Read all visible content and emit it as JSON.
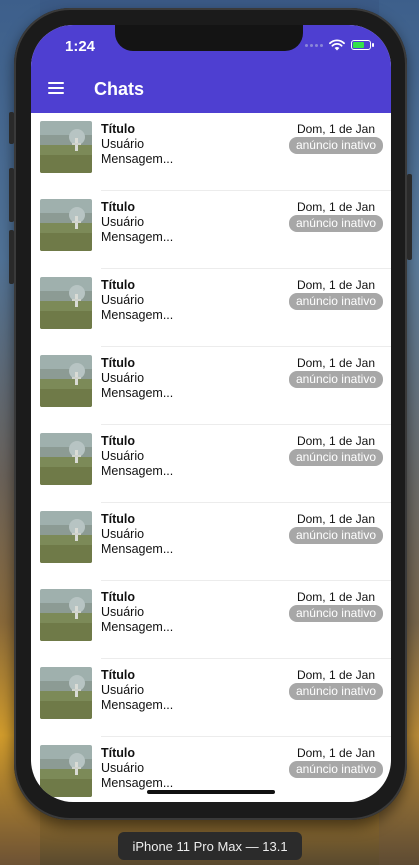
{
  "device": {
    "label": "iPhone 11 Pro Max — 13.1"
  },
  "status_bar": {
    "time": "1:24"
  },
  "header": {
    "title": "Chats"
  },
  "chats": [
    {
      "title": "Título",
      "user": "Usuário",
      "message": "Mensagem...",
      "date": "Dom, 1 de Jan",
      "badge": "anúncio inativo"
    },
    {
      "title": "Título",
      "user": "Usuário",
      "message": "Mensagem...",
      "date": "Dom, 1 de Jan",
      "badge": "anúncio inativo"
    },
    {
      "title": "Título",
      "user": "Usuário",
      "message": "Mensagem...",
      "date": "Dom, 1 de Jan",
      "badge": "anúncio inativo"
    },
    {
      "title": "Título",
      "user": "Usuário",
      "message": "Mensagem...",
      "date": "Dom, 1 de Jan",
      "badge": "anúncio inativo"
    },
    {
      "title": "Título",
      "user": "Usuário",
      "message": "Mensagem...",
      "date": "Dom, 1 de Jan",
      "badge": "anúncio inativo"
    },
    {
      "title": "Título",
      "user": "Usuário",
      "message": "Mensagem...",
      "date": "Dom, 1 de Jan",
      "badge": "anúncio inativo"
    },
    {
      "title": "Título",
      "user": "Usuário",
      "message": "Mensagem...",
      "date": "Dom, 1 de Jan",
      "badge": "anúncio inativo"
    },
    {
      "title": "Título",
      "user": "Usuário",
      "message": "Mensagem...",
      "date": "Dom, 1 de Jan",
      "badge": "anúncio inativo"
    },
    {
      "title": "Título",
      "user": "Usuário",
      "message": "Mensagem...",
      "date": "Dom, 1 de Jan",
      "badge": "anúncio inativo"
    }
  ],
  "colors": {
    "header": "#4e3fd1",
    "badge": "#a7a7a7",
    "battery": "#33e04a"
  },
  "icons": {
    "menu": "hamburger-menu-icon",
    "wifi": "wifi-icon",
    "battery": "battery-icon",
    "signal": "signal-dots-icon"
  }
}
